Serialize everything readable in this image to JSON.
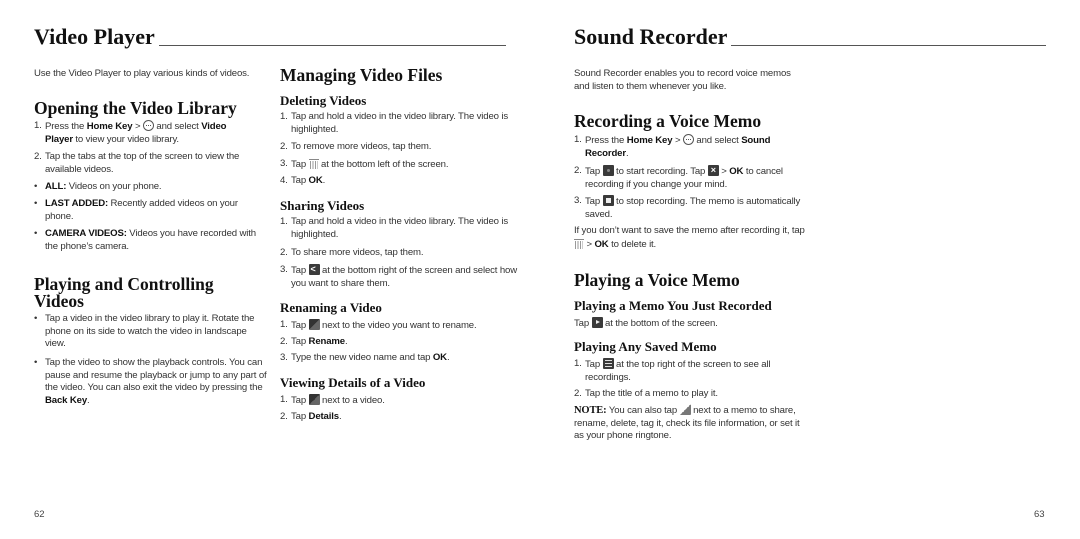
{
  "left_page": {
    "title": "Video Player",
    "intro": "Use the Video Player to play various kinds of videos.",
    "page_number": "62",
    "opening": {
      "heading": "Opening the Video Library",
      "step1": {
        "num": "1.",
        "a": "Press the ",
        "b1": "Home Key",
        "c": " > ",
        "d": " and select ",
        "b2": "Video Player",
        "e": " to view your video library."
      },
      "step2": {
        "num": "2.",
        "text": "Tap the tabs at the top of the screen to view the available videos."
      },
      "bullets": [
        {
          "label": "ALL:",
          "text": " Videos on your phone."
        },
        {
          "label": "LAST ADDED:",
          "text": " Recently added videos on your phone."
        },
        {
          "label": "CAMERA VIDEOS:",
          "text": " Videos you have recorded with the phone’s camera."
        }
      ]
    },
    "playing": {
      "heading": "Playing and Controlling Videos",
      "bullet1": "Tap a video in the video library to play it. Rotate the phone on its side to watch the video in landscape view.",
      "bullet2_a": "Tap the video to show the playback controls. You can pause and resume the playback or jump to any part of the video. You can also exit the video by pressing the ",
      "bullet2_b": "Back Key",
      "bullet2_c": "."
    },
    "managing": {
      "heading": "Managing Video Files",
      "deleting": {
        "heading": "Deleting Videos",
        "s1": "Tap and hold a video in the video library. The video is highlighted.",
        "s2": "To remove more videos, tap them.",
        "s3a": "Tap ",
        "s3b": " at the bottom left of the screen.",
        "s4a": "Tap ",
        "s4b": "OK",
        "s4c": "."
      },
      "sharing": {
        "heading": "Sharing Videos",
        "s1": "Tap and hold a video in the video library. The video is highlighted.",
        "s2": "To share more videos, tap them.",
        "s3a": "Tap ",
        "s3b": " at the bottom right of the screen and select how you want to share them."
      },
      "renaming": {
        "heading": "Renaming a Video",
        "s1a": "Tap ",
        "s1b": " next to the video you want to rename.",
        "s2a": "Tap ",
        "s2b": "Rename",
        "s2c": ".",
        "s3a": "Type the new video name and tap ",
        "s3b": "OK",
        "s3c": "."
      },
      "details": {
        "heading": "Viewing Details of a Video",
        "s1a": "Tap ",
        "s1b": " next to a video.",
        "s2a": "Tap ",
        "s2b": "Details",
        "s2c": "."
      }
    }
  },
  "right_page": {
    "title": "Sound Recorder",
    "intro": "Sound Recorder enables you to record voice memos and listen to them whenever you like.",
    "page_number": "63",
    "recording": {
      "heading": "Recording a Voice Memo",
      "s1a": "Press the ",
      "s1b": "Home Key",
      "s1c": " > ",
      "s1d": " and select ",
      "s1e": "Sound Recorder",
      "s1f": ".",
      "s2a": "Tap ",
      "s2b": " to start recording. Tap ",
      "s2c": " > ",
      "s2d": "OK",
      "s2e": " to cancel recording if you change your mind.",
      "s3a": "Tap ",
      "s3b": " to stop recording. The memo is automatically saved.",
      "after_a": "If you don’t want to save the memo after recording it, tap ",
      "after_b": " > ",
      "after_c": "OK",
      "after_d": " to delete it."
    },
    "playing": {
      "heading": "Playing a Voice Memo",
      "just": {
        "heading": "Playing a Memo You Just Recorded",
        "a": "Tap ",
        "b": " at the bottom of the screen."
      },
      "saved": {
        "heading": "Playing Any Saved Memo",
        "s1a": "Tap ",
        "s1b": " at the top right of the screen to see all recordings.",
        "s2": "Tap the title of a memo to play it."
      },
      "note": {
        "label": "NOTE:",
        "a": " You can also tap ",
        "b": " next to a memo to share, rename, delete, tag it, check its file information, or set it as your phone ringtone."
      }
    }
  }
}
